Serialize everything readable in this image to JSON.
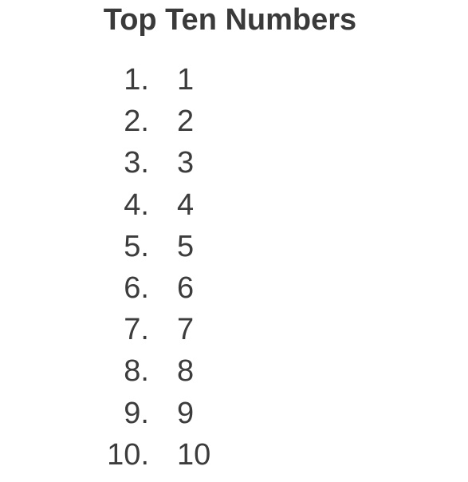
{
  "title": "Top Ten Numbers",
  "items": [
    {
      "index": "1.",
      "value": "1"
    },
    {
      "index": "2.",
      "value": "2"
    },
    {
      "index": "3.",
      "value": "3"
    },
    {
      "index": "4.",
      "value": "4"
    },
    {
      "index": "5.",
      "value": "5"
    },
    {
      "index": "6.",
      "value": "6"
    },
    {
      "index": "7.",
      "value": "7"
    },
    {
      "index": "8.",
      "value": "8"
    },
    {
      "index": "9.",
      "value": "9"
    },
    {
      "index": "10.",
      "value": "10"
    }
  ]
}
